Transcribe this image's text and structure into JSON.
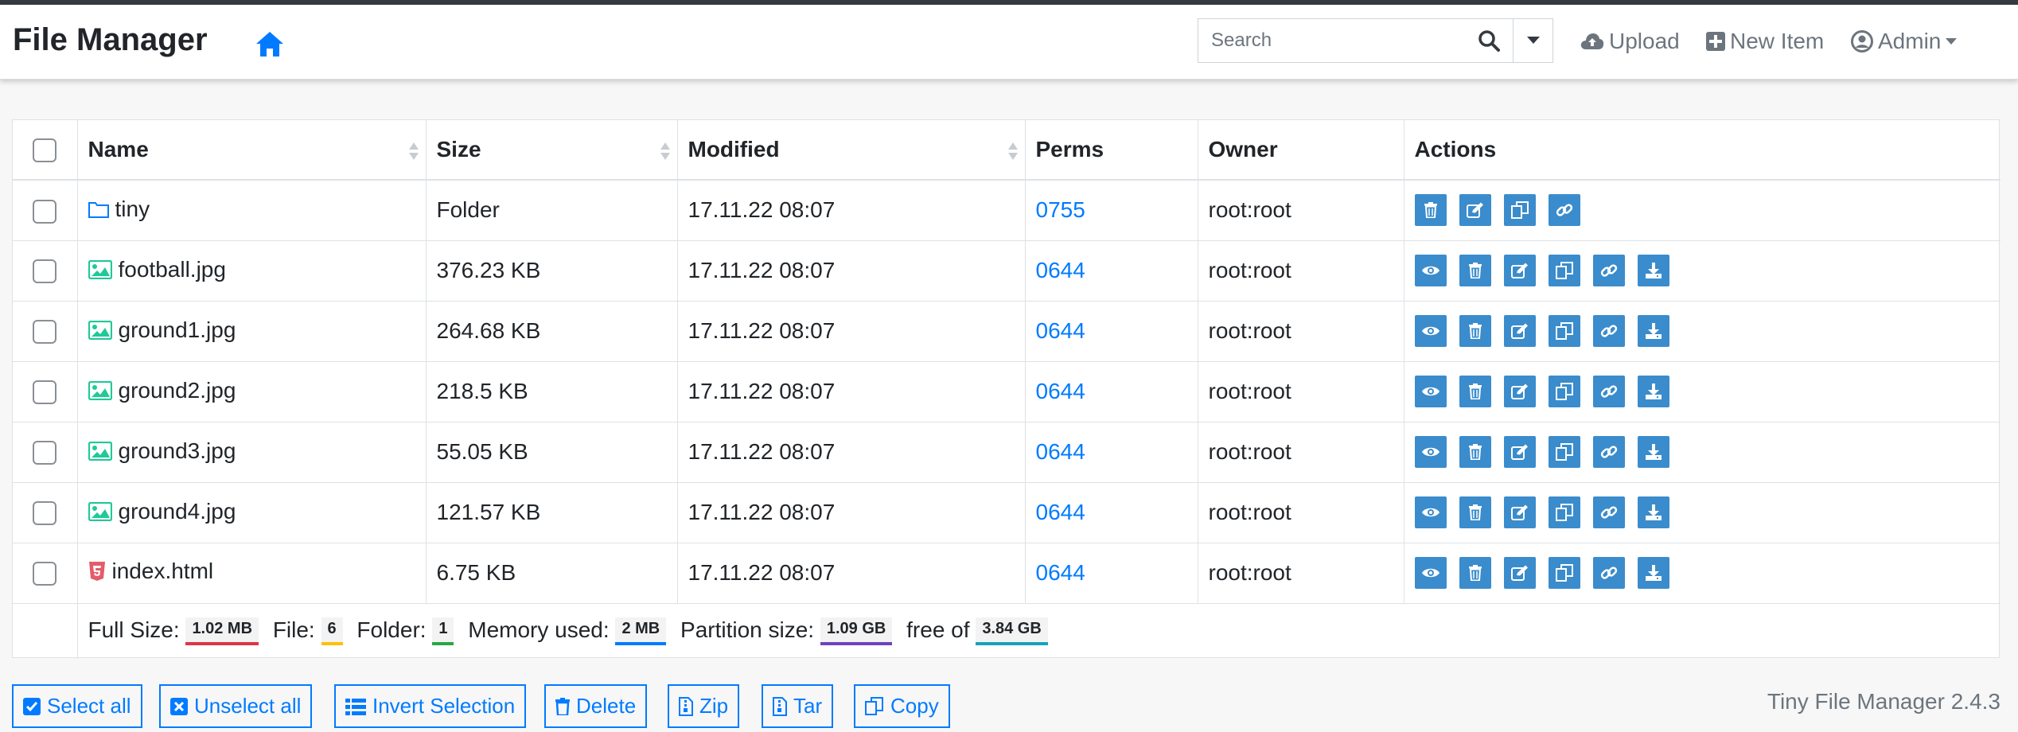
{
  "app": {
    "brand": "File Manager",
    "version": "Tiny File Manager 2.4.3"
  },
  "navbar": {
    "search_placeholder": "Search",
    "upload_label": "Upload",
    "new_item_label": "New Item",
    "admin_label": "Admin"
  },
  "table": {
    "headers": {
      "name": "Name",
      "size": "Size",
      "modified": "Modified",
      "perms": "Perms",
      "owner": "Owner",
      "actions": "Actions"
    },
    "rows": [
      {
        "icon": "folder-icon",
        "name": "tiny",
        "size": "Folder",
        "modified": "17.11.22 08:07",
        "perms": "0755",
        "owner": "root:root"
      },
      {
        "icon": "image-file-icon",
        "name": "football.jpg",
        "size": "376.23 KB",
        "modified": "17.11.22 08:07",
        "perms": "0644",
        "owner": "root:root"
      },
      {
        "icon": "image-file-icon",
        "name": "ground1.jpg",
        "size": "264.68 KB",
        "modified": "17.11.22 08:07",
        "perms": "0644",
        "owner": "root:root"
      },
      {
        "icon": "image-file-icon",
        "name": "ground2.jpg",
        "size": "218.5 KB",
        "modified": "17.11.22 08:07",
        "perms": "0644",
        "owner": "root:root"
      },
      {
        "icon": "image-file-icon",
        "name": "ground3.jpg",
        "size": "55.05 KB",
        "modified": "17.11.22 08:07",
        "perms": "0644",
        "owner": "root:root"
      },
      {
        "icon": "image-file-icon",
        "name": "ground4.jpg",
        "size": "121.57 KB",
        "modified": "17.11.22 08:07",
        "perms": "0644",
        "owner": "root:root"
      },
      {
        "icon": "html-file-icon",
        "name": "index.html",
        "size": "6.75 KB",
        "modified": "17.11.22 08:07",
        "perms": "0644",
        "owner": "root:root"
      }
    ],
    "footer": {
      "full_size_label": "Full Size:",
      "full_size_value": "1.02 MB",
      "file_label": "File:",
      "file_value": "6",
      "folder_label": "Folder:",
      "folder_value": "1",
      "memory_label": "Memory used:",
      "memory_value": "2 MB",
      "partition_label": "Partition size:",
      "partition_value": "1.09 GB",
      "free_label": "free of",
      "free_value": "3.84 GB"
    }
  },
  "bottom_buttons": {
    "select_all": "Select all",
    "unselect_all": "Unselect all",
    "invert_selection": "Invert Selection",
    "delete": "Delete",
    "zip": "Zip",
    "tar": "Tar",
    "copy": "Copy"
  },
  "colors": {
    "accent": "#007bff",
    "action_button": "#3a8ccc",
    "image_icon": "#20c997",
    "html_icon": "#e35d6a",
    "badge_full_size": "#dc3545",
    "badge_file": "#ffc107",
    "badge_folder": "#28a745",
    "badge_memory": "#007bff",
    "badge_partition": "#6f42c1",
    "badge_free": "#17a2b8"
  }
}
